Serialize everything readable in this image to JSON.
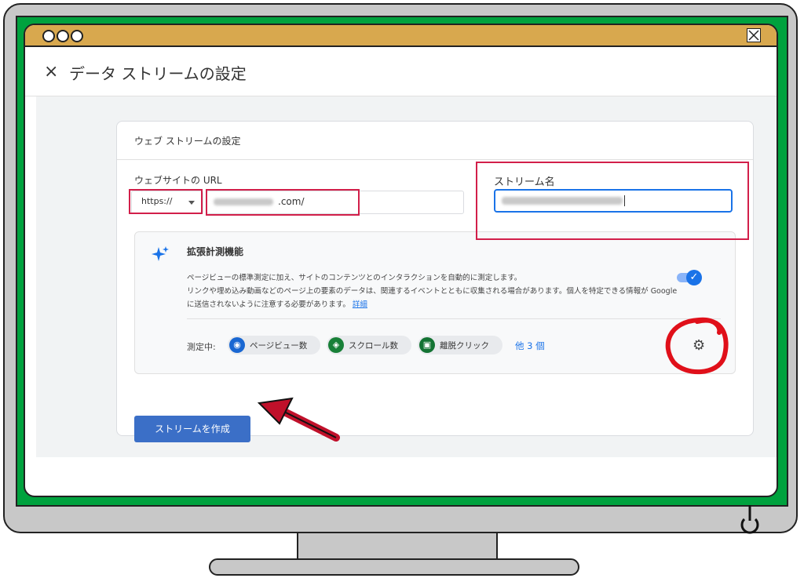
{
  "app": {
    "title": "データ ストリームの設定",
    "close_icon": "close-icon"
  },
  "card": {
    "title": "ウェブ ストリームの設定",
    "url_label": "ウェブサイトの URL",
    "protocol_value": "https://",
    "url_suffix": ".com/",
    "stream_name_label": "ストリーム名"
  },
  "enhanced": {
    "title": "拡張計測機能",
    "description_1": "ページビューの標準測定に加え、サイトのコンテンツとのインタラクションを自動的に測定します。",
    "description_2": "リンクや埋め込み動画などのページ上の要素のデータは、関連するイベントとともに収集される場合があります。個人を特定できる情報が Google に送信されないように注意する必要があります。",
    "detail_link": "詳細",
    "toggle_on": true,
    "measuring_label": "測定中:",
    "chips": [
      {
        "label": "ページビュー数",
        "icon": "eye-icon",
        "color": "#1967d2"
      },
      {
        "label": "スクロール数",
        "icon": "compass-icon",
        "color": "#188038"
      },
      {
        "label": "離脱クリック",
        "icon": "mouse-icon",
        "color": "#137333"
      }
    ],
    "more_link": "他 3 個",
    "settings_icon": "gear-icon"
  },
  "buttons": {
    "create_stream": "ストリームを作成"
  },
  "colors": {
    "accent": "#1a73e8",
    "highlight": "#d21f4a",
    "bezel": "#00a23e",
    "title_bar": "#d8a84e"
  }
}
